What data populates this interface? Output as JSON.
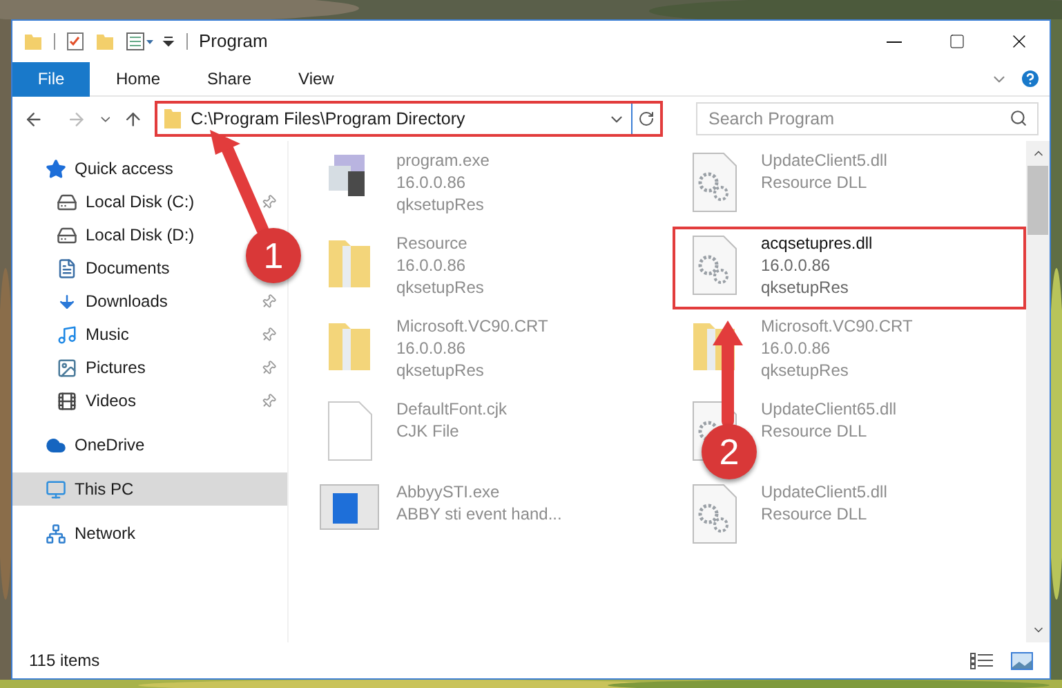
{
  "window": {
    "title": "Program"
  },
  "ribbon_tabs": [
    {
      "label": "File",
      "selected": true
    },
    {
      "label": "Home",
      "selected": false
    },
    {
      "label": "Share",
      "selected": false
    },
    {
      "label": "View",
      "selected": false
    }
  ],
  "address_bar": {
    "path": "C:\\Program Files\\Program Directory",
    "highlighted": true
  },
  "search": {
    "placeholder": "Search Program"
  },
  "sidebar": {
    "items": [
      {
        "label": "Quick access",
        "kind": "star",
        "selected": false,
        "pinned": false,
        "children": [
          {
            "label": "Local Disk (C:)",
            "kind": "disk",
            "selected": false,
            "pinned": true
          },
          {
            "label": "Local Disk (D:)",
            "kind": "disk",
            "selected": false,
            "pinned": false
          },
          {
            "label": "Documents",
            "kind": "documents",
            "selected": false,
            "pinned": false
          },
          {
            "label": "Downloads",
            "kind": "downloads",
            "selected": false,
            "pinned": true
          },
          {
            "label": "Music",
            "kind": "music",
            "selected": false,
            "pinned": true
          },
          {
            "label": "Pictures",
            "kind": "pictures",
            "selected": false,
            "pinned": true
          },
          {
            "label": "Videos",
            "kind": "videos",
            "selected": false,
            "pinned": true
          }
        ]
      },
      {
        "label": "OneDrive",
        "kind": "cloud",
        "selected": false,
        "pinned": false
      },
      {
        "label": "This PC",
        "kind": "pc",
        "selected": true,
        "pinned": false
      },
      {
        "label": "Network",
        "kind": "network",
        "selected": false,
        "pinned": false
      }
    ]
  },
  "files": [
    {
      "name": "program.exe",
      "details": [
        "16.0.0.86",
        "qksetupRes"
      ],
      "kind": "exe",
      "highlighted": false
    },
    {
      "name": "UpdateClient5.dll",
      "details": [
        "Resource DLL"
      ],
      "kind": "dll",
      "highlighted": false
    },
    {
      "name": "Resource",
      "details": [
        "16.0.0.86",
        "qksetupRes"
      ],
      "kind": "folder",
      "highlighted": false
    },
    {
      "name": "acqsetupres.dll",
      "details": [
        "16.0.0.86",
        "qksetupRes"
      ],
      "kind": "dll",
      "highlighted": true
    },
    {
      "name": "Microsoft.VC90.CRT",
      "details": [
        "16.0.0.86",
        "qksetupRes"
      ],
      "kind": "folder",
      "highlighted": false
    },
    {
      "name": "Microsoft.VC90.CRT",
      "details": [
        "16.0.0.86",
        "qksetupRes"
      ],
      "kind": "folder",
      "highlighted": false
    },
    {
      "name": "DefaultFont.cjk",
      "details": [
        "CJK File"
      ],
      "kind": "file",
      "highlighted": false
    },
    {
      "name": "UpdateClient65.dll",
      "details": [
        "Resource DLL"
      ],
      "kind": "dll",
      "highlighted": false
    },
    {
      "name": "AbbyySTI.exe",
      "details": [
        "ABBY sti event hand..."
      ],
      "kind": "app",
      "highlighted": false
    },
    {
      "name": "UpdateClient5.dll",
      "details": [
        "Resource DLL"
      ],
      "kind": "dll",
      "highlighted": false
    }
  ],
  "status_bar": {
    "item_count": "115 items"
  },
  "annotations": [
    {
      "label": "1"
    },
    {
      "label": "2"
    }
  ]
}
